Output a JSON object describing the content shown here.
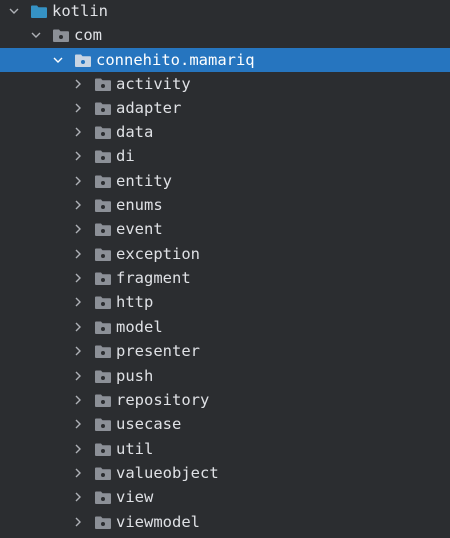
{
  "tree": {
    "root": {
      "label": "kotlin",
      "expanded": true,
      "icon": "source-root-folder-icon",
      "color": "#3592c4"
    },
    "com": {
      "label": "com",
      "expanded": true,
      "icon": "package-folder-icon"
    },
    "selected": {
      "label": "connehito.mamariq",
      "expanded": true,
      "icon": "package-folder-icon",
      "highlight": "#2675bf"
    },
    "packages": [
      {
        "label": "activity"
      },
      {
        "label": "adapter"
      },
      {
        "label": "data"
      },
      {
        "label": "di"
      },
      {
        "label": "entity"
      },
      {
        "label": "enums"
      },
      {
        "label": "event"
      },
      {
        "label": "exception"
      },
      {
        "label": "fragment"
      },
      {
        "label": "http"
      },
      {
        "label": "model"
      },
      {
        "label": "presenter"
      },
      {
        "label": "push"
      },
      {
        "label": "repository"
      },
      {
        "label": "usecase"
      },
      {
        "label": "util"
      },
      {
        "label": "valueobject"
      },
      {
        "label": "view"
      },
      {
        "label": "viewmodel"
      }
    ]
  },
  "colors": {
    "background": "#2b2d30",
    "text": "#dfe1e5",
    "folder": "#8c9097",
    "chevron": "#aeb1b6"
  }
}
